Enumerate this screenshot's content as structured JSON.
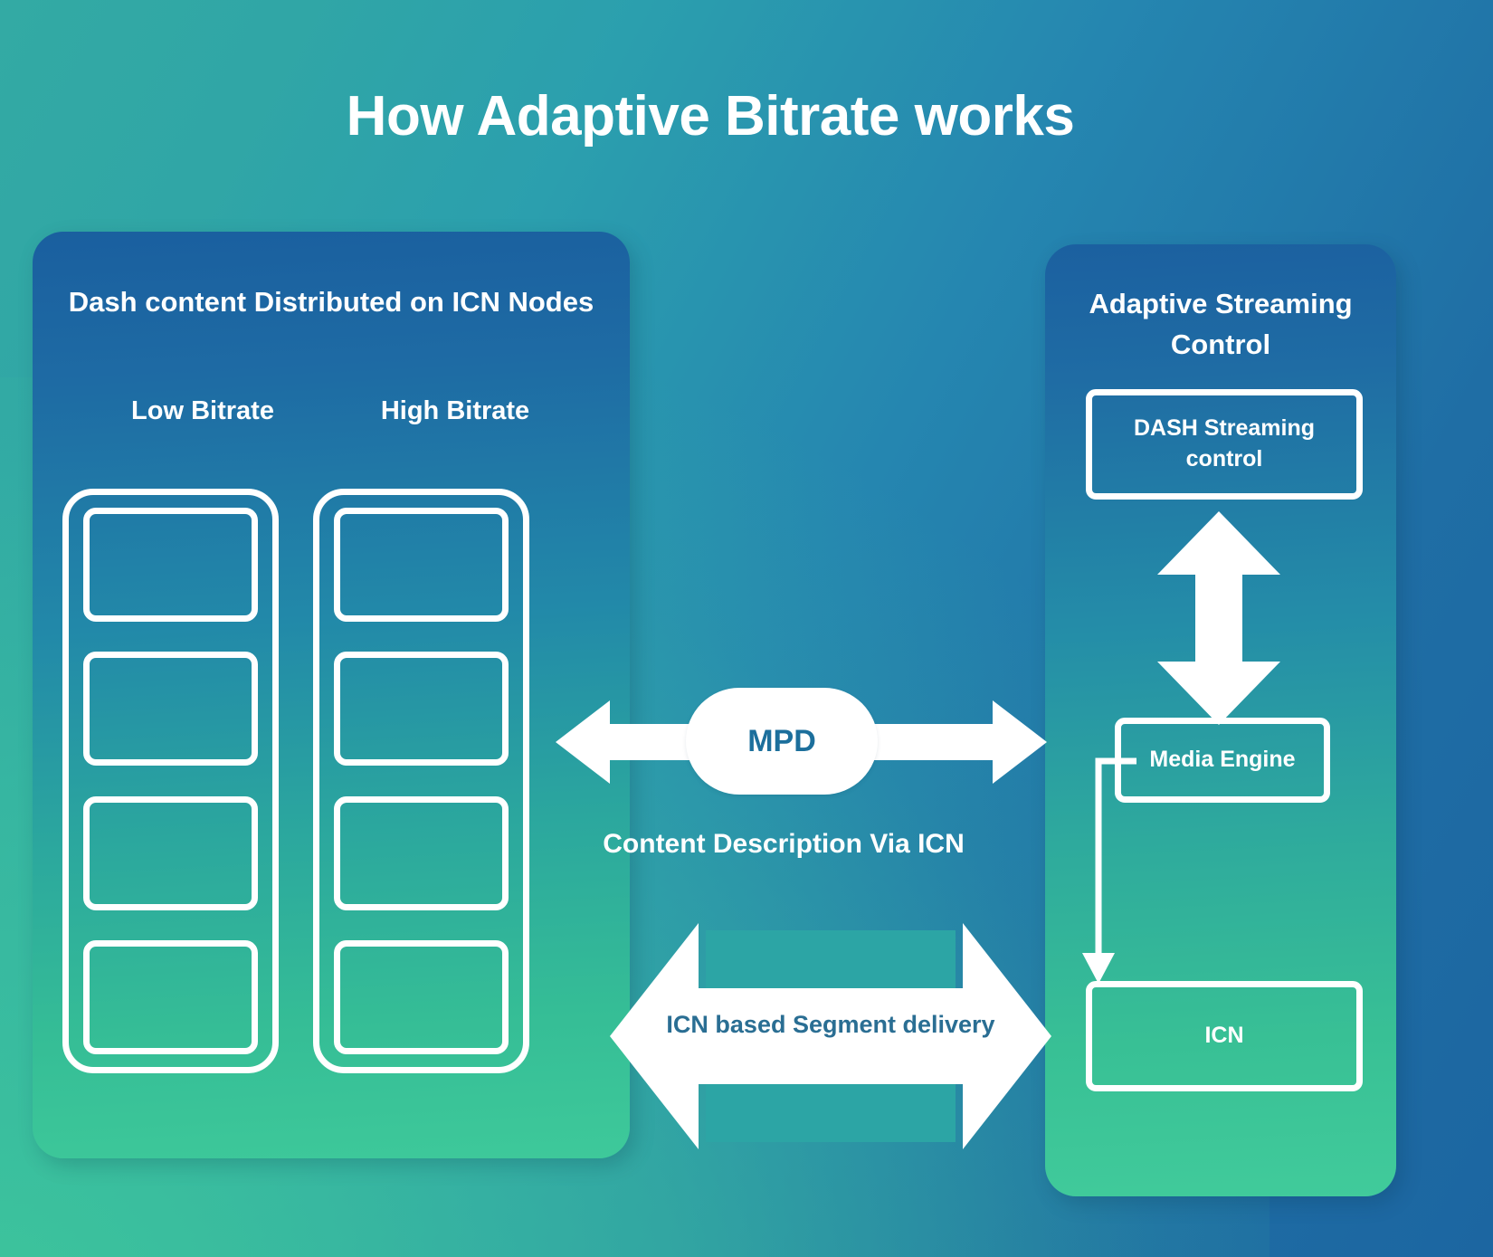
{
  "title": "How Adaptive Bitrate works",
  "colors": {
    "bg_teal": "#33aaa4",
    "bg_blue": "#1c66a1",
    "bg_green": "#3ec99a",
    "panel_top_blue": "#1a5f9f",
    "panel_bottom_green": "#3ec99a",
    "white": "#ffffff",
    "mpd_text": "#1c6f9c",
    "segment_label_text": "#2a6e93"
  },
  "left_panel": {
    "heading": "Dash content Distributed on ICN Nodes",
    "columns": [
      {
        "label": "Low Bitrate",
        "name": "low-bitrate",
        "segments": [
          "",
          "",
          "",
          ""
        ]
      },
      {
        "label": "High Bitrate",
        "name": "high-bitrate",
        "segments": [
          "",
          "",
          "",
          ""
        ]
      }
    ]
  },
  "right_panel": {
    "heading": "Adaptive Streaming Control",
    "boxes": [
      {
        "name": "dash-streaming-control",
        "label": "DASH Streaming control"
      },
      {
        "name": "media-engine",
        "label": "Media Engine"
      },
      {
        "name": "icn",
        "label": "ICN"
      }
    ]
  },
  "center": {
    "mpd_label": "MPD",
    "content_description": "Content Description Via ICN",
    "segment_delivery_label": "ICN based Segment delivery"
  },
  "icons": {
    "vertical_double_arrow": "double-arrow-vertical-icon",
    "horizontal_double_arrow": "double-arrow-horizontal-icon",
    "segment_delivery_arrow": "double-arrow-outline-icon",
    "elbow_connector": "elbow-arrow-icon"
  }
}
